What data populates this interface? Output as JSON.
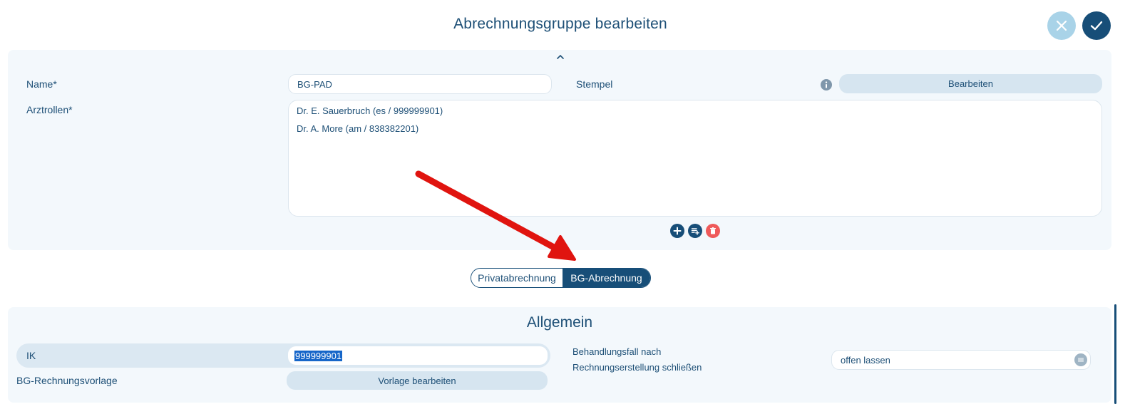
{
  "header": {
    "title": "Abrechnungsgruppe bearbeiten",
    "cancel_icon": "close-icon",
    "confirm_icon": "check-icon"
  },
  "form": {
    "name_label": "Name*",
    "name_value": "BG-PAD",
    "stempel_label": "Stempel",
    "stempel_button": "Bearbeiten",
    "arztrollen_label": "Arztrollen*",
    "arztrollen": [
      "Dr. E. Sauerbruch (es / 999999901)",
      "Dr. A. More (am / 838382201)"
    ]
  },
  "toggle": {
    "option_1": "Privatabrechnung",
    "option_2": "BG-Abrechnung",
    "selected": "BG-Abrechnung"
  },
  "allgemein": {
    "title": "Allgemein",
    "ik_label": "IK",
    "ik_value": "999999901",
    "vorlage_label": "BG-Rechnungsvorlage",
    "vorlage_button": "Vorlage bearbeiten",
    "behandlung_label_line1": "Behandlungsfall nach",
    "behandlung_label_line2": "Rechnungserstellung schließen",
    "behandlung_value": "offen lassen"
  },
  "colors": {
    "primary": "#174e78",
    "accent_light": "#a9d3e8",
    "panel": "#f3f8fc",
    "delete": "#ef5a5a",
    "annotation_arrow": "#e0140f"
  }
}
